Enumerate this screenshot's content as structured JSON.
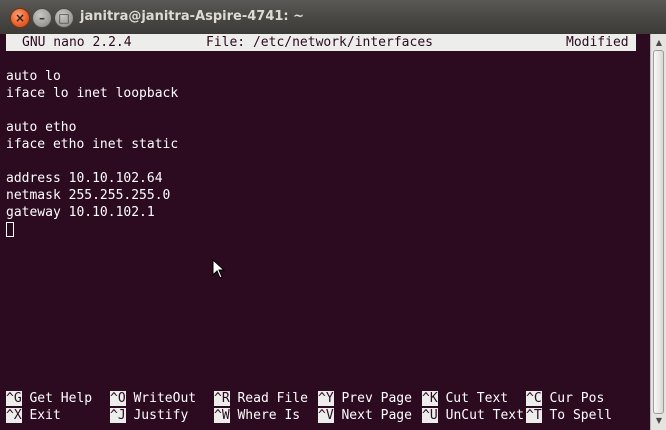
{
  "window": {
    "title": "janitra@janitra-Aspire-4741: ~"
  },
  "nano": {
    "version": "GNU nano 2.2.4",
    "file_label": "File: /etc/network/interfaces",
    "state": "Modified"
  },
  "file_lines": [
    "",
    "auto lo",
    "iface lo inet loopback",
    "",
    "auto etho",
    "iface etho inet static",
    "",
    "address 10.10.102.64",
    "netmask 255.255.255.0",
    "gateway 10.10.102.1"
  ],
  "shortcuts": {
    "row1": [
      {
        "key": "^G",
        "label": "Get Help"
      },
      {
        "key": "^O",
        "label": "WriteOut"
      },
      {
        "key": "^R",
        "label": "Read File"
      },
      {
        "key": "^Y",
        "label": "Prev Page"
      },
      {
        "key": "^K",
        "label": "Cut Text"
      },
      {
        "key": "^C",
        "label": "Cur Pos"
      }
    ],
    "row2": [
      {
        "key": "^X",
        "label": "Exit"
      },
      {
        "key": "^J",
        "label": "Justify"
      },
      {
        "key": "^W",
        "label": "Where Is"
      },
      {
        "key": "^V",
        "label": "Next Page"
      },
      {
        "key": "^U",
        "label": "UnCut Text"
      },
      {
        "key": "^T",
        "label": "To Spell"
      }
    ]
  },
  "colors": {
    "terminal_bg": "#2c0a1f",
    "terminal_fg": "#ffffff",
    "highlight_bg": "#ededec",
    "titlebar": "#3c3b37",
    "close_button": "#e9642f"
  },
  "icons": {
    "close": "close-icon",
    "minimize": "minimize-icon",
    "maximize": "maximize-icon",
    "pointer": "mouse-pointer-icon"
  }
}
